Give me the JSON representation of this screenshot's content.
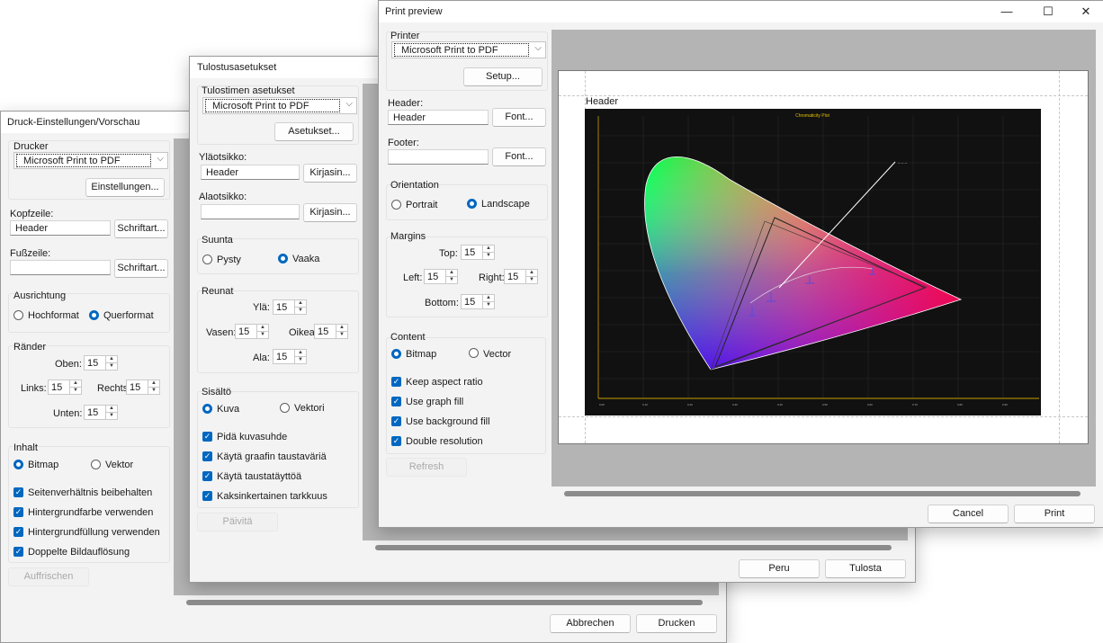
{
  "german": {
    "title": "Druck-Einstellungen/Vorschau",
    "printer_label": "Drucker",
    "printer_value": "Microsoft Print to PDF",
    "setup_button": "Einstellungen...",
    "header_label": "Kopfzeile:",
    "header_value": "Header",
    "header_font_button": "Schriftart...",
    "footer_label": "Fußzeile:",
    "footer_value": "",
    "footer_font_button": "Schriftart...",
    "orientation_label": "Ausrichtung",
    "portrait": "Hochformat",
    "landscape": "Querformat",
    "margins_label": "Ränder",
    "top_label": "Oben:",
    "left_label": "Links:",
    "right_label": "Rechts:",
    "bottom_label": "Unten:",
    "margin_value": "15",
    "content_label": "Inhalt",
    "bitmap": "Bitmap",
    "vector": "Vektor",
    "checks": [
      "Seitenverhältnis beibehalten",
      "Hintergrundfarbe verwenden",
      "Hintergrundfüllung verwenden",
      "Doppelte Bildauflösung"
    ],
    "refresh_button": "Auffrischen",
    "cancel_button": "Abbrechen",
    "print_button": "Drucken"
  },
  "finnish": {
    "title": "Tulostusasetukset",
    "printer_label": "Tulostimen asetukset",
    "printer_value": "Microsoft Print to PDF",
    "setup_button": "Asetukset...",
    "header_label": "Yläotsikko:",
    "header_value": "Header",
    "header_font_button": "Kirjasin...",
    "footer_label": "Alaotsikko:",
    "footer_value": "",
    "footer_font_button": "Kirjasin...",
    "orientation_label": "Suunta",
    "portrait": "Pysty",
    "landscape": "Vaaka",
    "margins_label": "Reunat",
    "top_label": "Ylä:",
    "left_label": "Vasen:",
    "right_label": "Oikea:",
    "bottom_label": "Ala:",
    "margin_value": "15",
    "content_label": "Sisältö",
    "bitmap": "Kuva",
    "vector": "Vektori",
    "checks": [
      "Pidä kuvasuhde",
      "Käytä graafin taustaväriä",
      "Käytä taustatäyttöä",
      "Kaksinkertainen tarkkuus"
    ],
    "refresh_button": "Päivitä",
    "cancel_button": "Peru",
    "print_button": "Tulosta"
  },
  "english": {
    "title": "Print preview",
    "minimize_icon": "—",
    "maximize_icon": "☐",
    "close_icon": "✕",
    "printer_label": "Printer",
    "printer_value": "Microsoft Print to PDF",
    "setup_button": "Setup...",
    "header_label": "Header:",
    "header_value": "Header",
    "header_font_button": "Font...",
    "footer_label": "Footer:",
    "footer_value": "",
    "footer_font_button": "Font...",
    "orientation_label": "Orientation",
    "portrait": "Portrait",
    "landscape": "Landscape",
    "margins_label": "Margins",
    "top_label": "Top:",
    "left_label": "Left:",
    "right_label": "Right:",
    "bottom_label": "Bottom:",
    "margin_value": "15",
    "content_label": "Content",
    "bitmap": "Bitmap",
    "vector": "Vector",
    "checks": [
      "Keep aspect ratio",
      "Use graph fill",
      "Use background fill",
      "Double resolution"
    ],
    "refresh_button": "Refresh",
    "cancel_button": "Cancel",
    "print_button": "Print"
  },
  "preview": {
    "page_header": "Header",
    "chart_title": "Chromaticity Plot",
    "chart_bg": "#111111",
    "marker_color": "#5b4bd6"
  }
}
